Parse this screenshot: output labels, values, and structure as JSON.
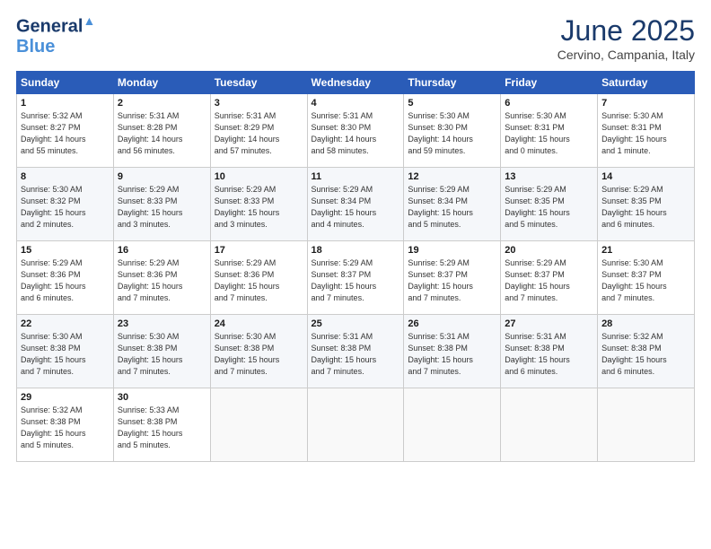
{
  "header": {
    "logo_line1": "General",
    "logo_line2": "Blue",
    "month_title": "June 2025",
    "location": "Cervino, Campania, Italy"
  },
  "days_of_week": [
    "Sunday",
    "Monday",
    "Tuesday",
    "Wednesday",
    "Thursday",
    "Friday",
    "Saturday"
  ],
  "weeks": [
    [
      {
        "day": "1",
        "info": "Sunrise: 5:32 AM\nSunset: 8:27 PM\nDaylight: 14 hours\nand 55 minutes."
      },
      {
        "day": "2",
        "info": "Sunrise: 5:31 AM\nSunset: 8:28 PM\nDaylight: 14 hours\nand 56 minutes."
      },
      {
        "day": "3",
        "info": "Sunrise: 5:31 AM\nSunset: 8:29 PM\nDaylight: 14 hours\nand 57 minutes."
      },
      {
        "day": "4",
        "info": "Sunrise: 5:31 AM\nSunset: 8:30 PM\nDaylight: 14 hours\nand 58 minutes."
      },
      {
        "day": "5",
        "info": "Sunrise: 5:30 AM\nSunset: 8:30 PM\nDaylight: 14 hours\nand 59 minutes."
      },
      {
        "day": "6",
        "info": "Sunrise: 5:30 AM\nSunset: 8:31 PM\nDaylight: 15 hours\nand 0 minutes."
      },
      {
        "day": "7",
        "info": "Sunrise: 5:30 AM\nSunset: 8:31 PM\nDaylight: 15 hours\nand 1 minute."
      }
    ],
    [
      {
        "day": "8",
        "info": "Sunrise: 5:30 AM\nSunset: 8:32 PM\nDaylight: 15 hours\nand 2 minutes."
      },
      {
        "day": "9",
        "info": "Sunrise: 5:29 AM\nSunset: 8:33 PM\nDaylight: 15 hours\nand 3 minutes."
      },
      {
        "day": "10",
        "info": "Sunrise: 5:29 AM\nSunset: 8:33 PM\nDaylight: 15 hours\nand 3 minutes."
      },
      {
        "day": "11",
        "info": "Sunrise: 5:29 AM\nSunset: 8:34 PM\nDaylight: 15 hours\nand 4 minutes."
      },
      {
        "day": "12",
        "info": "Sunrise: 5:29 AM\nSunset: 8:34 PM\nDaylight: 15 hours\nand 5 minutes."
      },
      {
        "day": "13",
        "info": "Sunrise: 5:29 AM\nSunset: 8:35 PM\nDaylight: 15 hours\nand 5 minutes."
      },
      {
        "day": "14",
        "info": "Sunrise: 5:29 AM\nSunset: 8:35 PM\nDaylight: 15 hours\nand 6 minutes."
      }
    ],
    [
      {
        "day": "15",
        "info": "Sunrise: 5:29 AM\nSunset: 8:36 PM\nDaylight: 15 hours\nand 6 minutes."
      },
      {
        "day": "16",
        "info": "Sunrise: 5:29 AM\nSunset: 8:36 PM\nDaylight: 15 hours\nand 7 minutes."
      },
      {
        "day": "17",
        "info": "Sunrise: 5:29 AM\nSunset: 8:36 PM\nDaylight: 15 hours\nand 7 minutes."
      },
      {
        "day": "18",
        "info": "Sunrise: 5:29 AM\nSunset: 8:37 PM\nDaylight: 15 hours\nand 7 minutes."
      },
      {
        "day": "19",
        "info": "Sunrise: 5:29 AM\nSunset: 8:37 PM\nDaylight: 15 hours\nand 7 minutes."
      },
      {
        "day": "20",
        "info": "Sunrise: 5:29 AM\nSunset: 8:37 PM\nDaylight: 15 hours\nand 7 minutes."
      },
      {
        "day": "21",
        "info": "Sunrise: 5:30 AM\nSunset: 8:37 PM\nDaylight: 15 hours\nand 7 minutes."
      }
    ],
    [
      {
        "day": "22",
        "info": "Sunrise: 5:30 AM\nSunset: 8:38 PM\nDaylight: 15 hours\nand 7 minutes."
      },
      {
        "day": "23",
        "info": "Sunrise: 5:30 AM\nSunset: 8:38 PM\nDaylight: 15 hours\nand 7 minutes."
      },
      {
        "day": "24",
        "info": "Sunrise: 5:30 AM\nSunset: 8:38 PM\nDaylight: 15 hours\nand 7 minutes."
      },
      {
        "day": "25",
        "info": "Sunrise: 5:31 AM\nSunset: 8:38 PM\nDaylight: 15 hours\nand 7 minutes."
      },
      {
        "day": "26",
        "info": "Sunrise: 5:31 AM\nSunset: 8:38 PM\nDaylight: 15 hours\nand 7 minutes."
      },
      {
        "day": "27",
        "info": "Sunrise: 5:31 AM\nSunset: 8:38 PM\nDaylight: 15 hours\nand 6 minutes."
      },
      {
        "day": "28",
        "info": "Sunrise: 5:32 AM\nSunset: 8:38 PM\nDaylight: 15 hours\nand 6 minutes."
      }
    ],
    [
      {
        "day": "29",
        "info": "Sunrise: 5:32 AM\nSunset: 8:38 PM\nDaylight: 15 hours\nand 5 minutes."
      },
      {
        "day": "30",
        "info": "Sunrise: 5:33 AM\nSunset: 8:38 PM\nDaylight: 15 hours\nand 5 minutes."
      },
      {
        "day": "",
        "info": ""
      },
      {
        "day": "",
        "info": ""
      },
      {
        "day": "",
        "info": ""
      },
      {
        "day": "",
        "info": ""
      },
      {
        "day": "",
        "info": ""
      }
    ]
  ]
}
